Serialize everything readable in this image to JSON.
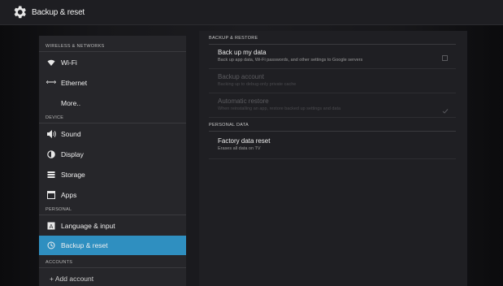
{
  "header": {
    "title": "Backup & reset",
    "icon": "gear-icon"
  },
  "sidebar": {
    "sections": [
      {
        "label": "WIRELESS & NETWORKS"
      },
      {
        "label": "DEVICE"
      },
      {
        "label": "PERSONAL"
      },
      {
        "label": "ACCOUNTS"
      }
    ],
    "items": [
      {
        "label": "Wi-Fi",
        "icon": "wifi-icon"
      },
      {
        "label": "Ethernet",
        "icon": "ethernet-icon"
      },
      {
        "label": "More..",
        "icon": ""
      },
      {
        "label": "Sound",
        "icon": "sound-icon"
      },
      {
        "label": "Display",
        "icon": "display-icon"
      },
      {
        "label": "Storage",
        "icon": "storage-icon"
      },
      {
        "label": "Apps",
        "icon": "apps-icon"
      },
      {
        "label": "Language & input",
        "icon": "language-icon"
      },
      {
        "label": "Backup & reset",
        "icon": "backup-icon",
        "selected": true
      },
      {
        "label": "+ Add account",
        "icon": "add-icon"
      }
    ]
  },
  "content": {
    "backup_section": "BACKUP & RESTORE",
    "backup_my_data": {
      "title": "Back up my data",
      "summary": "Back up app data, Wi-Fi passwords, and other settings to Google servers"
    },
    "backup_account": {
      "title": "Backup account",
      "summary": "Backing up to debug-only private cache"
    },
    "auto_restore": {
      "title": "Automatic restore",
      "summary": "When reinstalling an app, restore backed up settings and data"
    },
    "personal_section": "PERSONAL DATA",
    "factory_reset": {
      "title": "Factory data reset",
      "summary": "Erases all data on TV"
    }
  },
  "colors": {
    "accent": "#2f8fc0",
    "sidebar_bg": "#26262a",
    "content_bg": "#1f1f23"
  }
}
